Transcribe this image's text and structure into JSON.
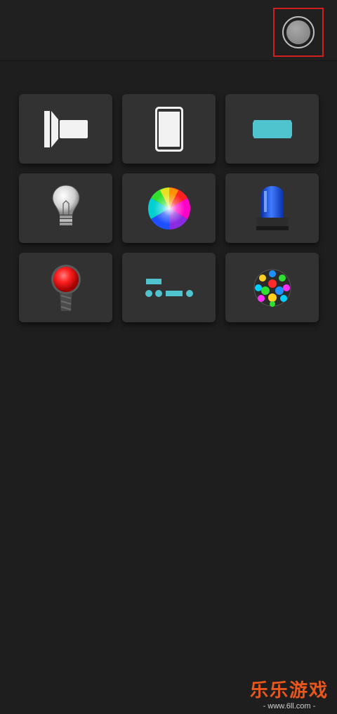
{
  "topbar": {
    "settings_icon": "circle-toggle-icon"
  },
  "tiles": [
    {
      "name": "flashlight",
      "icon": "flashlight-icon"
    },
    {
      "name": "screen-light",
      "icon": "phone-screen-icon"
    },
    {
      "name": "color-bar",
      "icon": "cyan-bar-icon"
    },
    {
      "name": "bulb",
      "icon": "light-bulb-icon"
    },
    {
      "name": "color-wheel",
      "icon": "color-wheel-icon"
    },
    {
      "name": "police-light",
      "icon": "blue-siren-icon"
    },
    {
      "name": "red-button",
      "icon": "red-beacon-icon"
    },
    {
      "name": "morse",
      "icon": "morse-code-icon"
    },
    {
      "name": "disco",
      "icon": "disco-ball-icon"
    }
  ],
  "watermark": {
    "title": "乐乐游戏",
    "url": "- www.6ll.com -"
  },
  "colors": {
    "background": "#1e1e1e",
    "tile": "#323232",
    "accent_cyan": "#4fc4cf",
    "highlight_border": "#d0201e",
    "watermark": "#e8571c"
  }
}
